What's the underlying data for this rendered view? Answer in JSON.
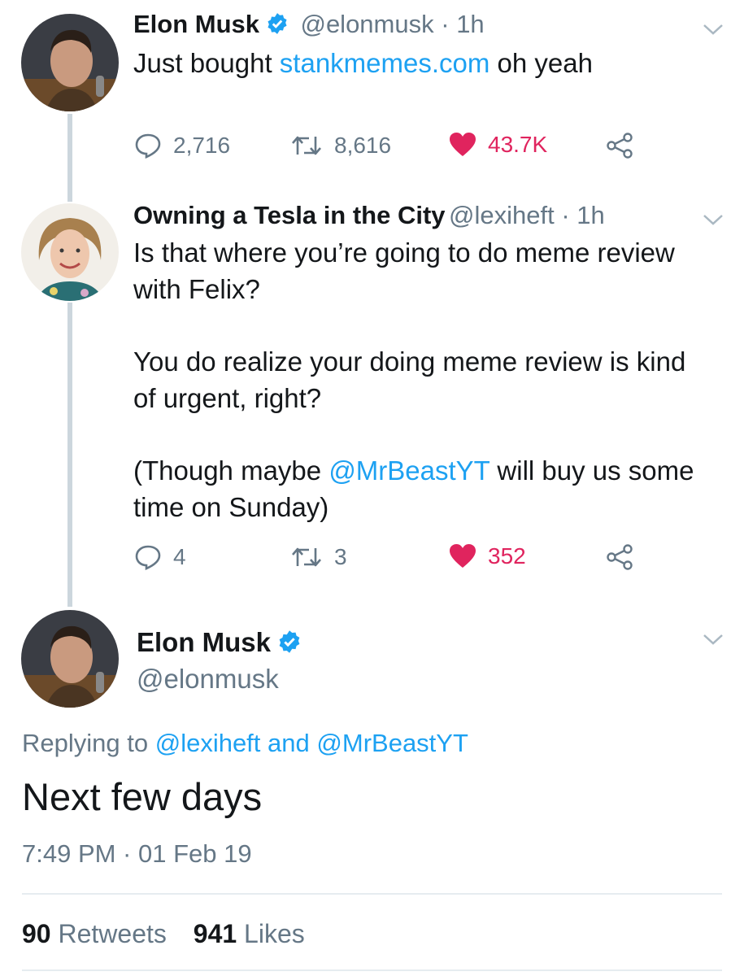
{
  "tweet1": {
    "name": "Elon Musk",
    "handle": "@elonmusk",
    "time": "1h",
    "text_before": "Just bought ",
    "link": "stankmemes.com",
    "text_after": " oh yeah",
    "replies": "2,716",
    "retweets": "8,616",
    "likes": "43.7K"
  },
  "tweet2": {
    "name": "Owning a Tesla in the City",
    "handle": "@lexiheft",
    "time": "1h",
    "para1_line1": "Is that where you’re going to do meme review",
    "para1_line2": "with Felix?",
    "para2_line1": "You do realize your doing meme review is kind",
    "para2_line2": "of urgent, right?",
    "para3_before": "(Though maybe ",
    "para3_mention": "@MrBeastYT",
    "para3_after": " will buy us some",
    "para3_line2": "time on Sunday)",
    "replies": "4",
    "retweets": "3",
    "likes": "352"
  },
  "main_tweet": {
    "name": "Elon Musk",
    "handle": "@elonmusk",
    "replying_prefix": "Replying to",
    "reply_to_1": "@lexiheft",
    "reply_and": "and",
    "reply_to_2": "@MrBeastYT",
    "text": "Next few days",
    "timestamp": "7:49 PM · 01 Feb 19",
    "retweet_count": "90",
    "retweet_label": "Retweets",
    "like_count": "941",
    "like_label": "Likes"
  },
  "colors": {
    "link": "#1da1f2",
    "like": "#e0245e",
    "muted": "#657786"
  },
  "icons": [
    "reply-icon",
    "retweet-icon",
    "heart-icon",
    "share-icon",
    "verified-badge-icon",
    "chevron-down-icon"
  ]
}
